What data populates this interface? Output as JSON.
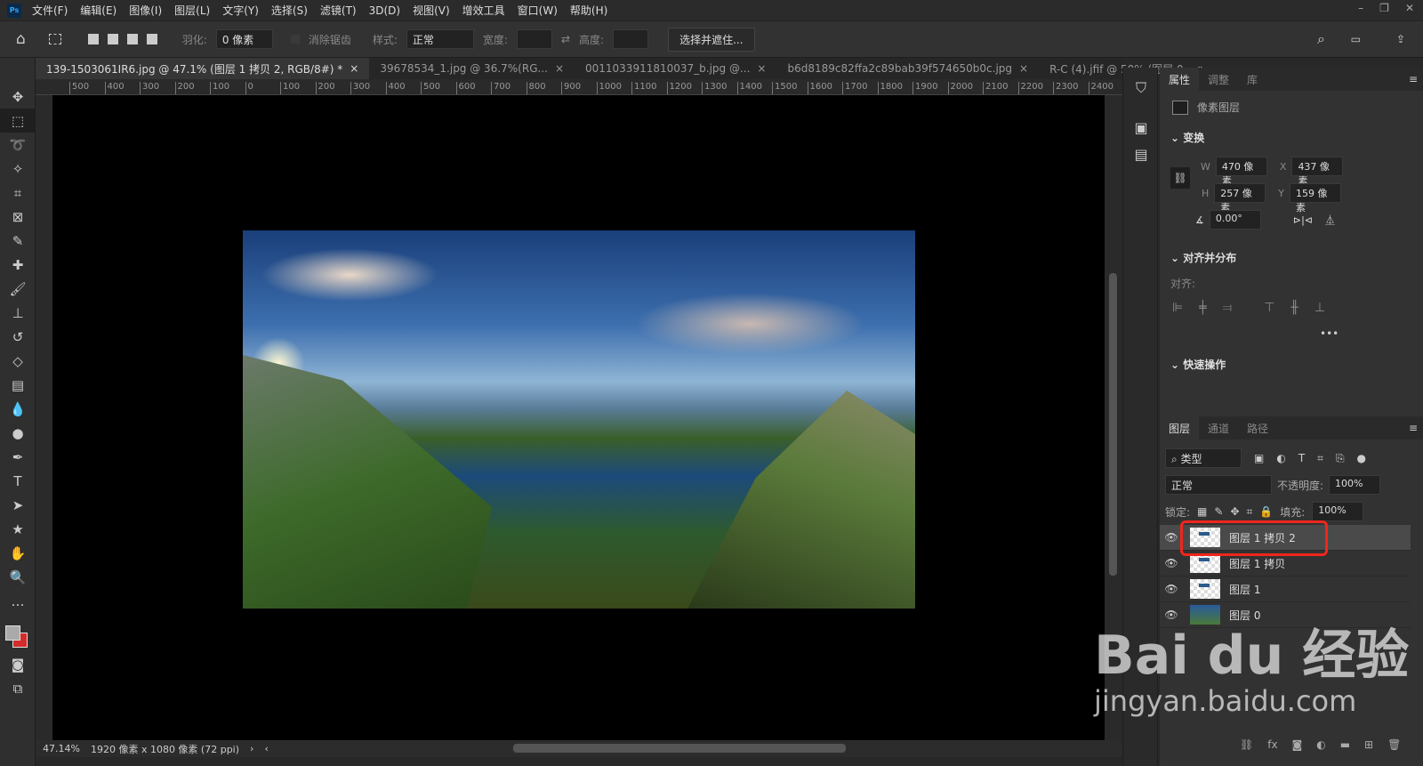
{
  "app": {
    "logo": "Ps"
  },
  "menu": [
    "文件(F)",
    "编辑(E)",
    "图像(I)",
    "图层(L)",
    "文字(Y)",
    "选择(S)",
    "滤镜(T)",
    "3D(D)",
    "视图(V)",
    "增效工具",
    "窗口(W)",
    "帮助(H)"
  ],
  "options": {
    "feather_label": "羽化:",
    "feather_value": "0 像素",
    "antialias_label": "消除锯齿",
    "style_label": "样式:",
    "style_value": "正常",
    "width_label": "宽度:",
    "height_label": "高度:",
    "select_mask_button": "选择并遮住..."
  },
  "tabs": [
    {
      "label": "139-1503061IR6.jpg @ 47.1% (图层 1 拷贝 2, RGB/8#) *",
      "active": true
    },
    {
      "label": "39678534_1.jpg @ 36.7%(RG..."
    },
    {
      "label": "0011033911810037_b.jpg @..."
    },
    {
      "label": "b6d8189c82ffa2c89bab39f574650b0c.jpg"
    },
    {
      "label": "R-C (4).jfif @ 50% (图层 0,"
    }
  ],
  "ruler": [
    "500",
    "400",
    "300",
    "200",
    "100",
    "0",
    "100",
    "200",
    "300",
    "400",
    "500",
    "600",
    "700",
    "800",
    "900",
    "1000",
    "1100",
    "1200",
    "1300",
    "1400",
    "1500",
    "1600",
    "1700",
    "1800",
    "1900",
    "2000",
    "2100",
    "2200",
    "2300",
    "2400"
  ],
  "status": {
    "zoom": "47.14%",
    "doc_info": "1920 像素 x 1080 像素 (72 ppi)"
  },
  "properties": {
    "tabs": [
      "属性",
      "调整",
      "库"
    ],
    "layer_type": "像素图层",
    "transform_title": "变换",
    "w_label": "W",
    "w_value": "470 像素",
    "x_label": "X",
    "x_value": "437 像素",
    "h_label": "H",
    "h_value": "257 像素",
    "y_label": "Y",
    "y_value": "159 像素",
    "angle_value": "0.00°",
    "align_title": "对齐并分布",
    "align_label": "对齐:",
    "more": "•••",
    "quick_title": "快速操作"
  },
  "layers": {
    "tabs": [
      "图层",
      "通道",
      "路径"
    ],
    "filter_value": "类型",
    "blend_mode": "正常",
    "opacity_label": "不透明度:",
    "opacity_value": "100%",
    "lock_label": "锁定:",
    "fill_label": "填充:",
    "fill_value": "100%",
    "items": [
      {
        "name": "图层 1 拷贝 2",
        "selected": true
      },
      {
        "name": "图层 1 拷贝"
      },
      {
        "name": "图层 1"
      },
      {
        "name": "图层 0"
      }
    ]
  },
  "watermark": {
    "brand": "Bai du 经验",
    "url": "jingyan.baidu.com"
  },
  "colors": {
    "highlight": "#f0261e",
    "accent": "#31a8ff"
  }
}
